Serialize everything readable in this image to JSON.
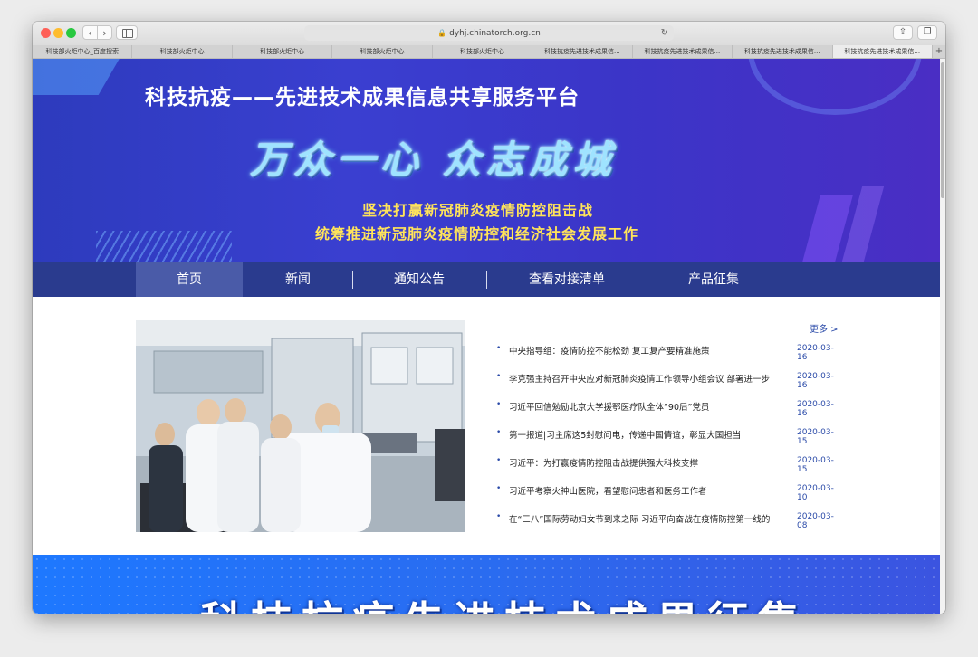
{
  "browser": {
    "url": "dyhj.chinatorch.org.cn",
    "tabs": [
      {
        "label": "科技部火炬中心_百度搜索",
        "active": false
      },
      {
        "label": "科技部火炬中心",
        "active": false
      },
      {
        "label": "科技部火炬中心",
        "active": false
      },
      {
        "label": "科技部火炬中心",
        "active": false
      },
      {
        "label": "科技部火炬中心",
        "active": false
      },
      {
        "label": "科技抗疫先进技术成果信...",
        "active": false
      },
      {
        "label": "科技抗疫先进技术成果信...",
        "active": false
      },
      {
        "label": "科技抗疫先进技术成果信...",
        "active": false
      },
      {
        "label": "科技抗疫先进技术成果信...",
        "active": true
      }
    ],
    "new_tab": "+"
  },
  "banner": {
    "title": "科技抗疫——先进技术成果信息共享服务平台",
    "slogan": "万众一心  众志成城",
    "sub1": "坚决打赢新冠肺炎疫情防控阻击战",
    "sub2": "统筹推进新冠肺炎疫情防控和经济社会发展工作"
  },
  "nav": {
    "items": [
      {
        "label": "首页",
        "active": true
      },
      {
        "label": "新闻",
        "active": false
      },
      {
        "label": "通知公告",
        "active": false
      },
      {
        "label": "查看对接清单",
        "active": false
      },
      {
        "label": "产品征集",
        "active": false
      }
    ]
  },
  "news": {
    "more": "更多 >",
    "items": [
      {
        "title": "中央指导组：疫情防控不能松劲 复工复产要精准施策",
        "date": "2020-03-16"
      },
      {
        "title": "李克强主持召开中央应对新冠肺炎疫情工作领导小组会议 部署进一步",
        "date": "2020-03-16"
      },
      {
        "title": "习近平回信勉励北京大学援鄂医疗队全体“90后”党员",
        "date": "2020-03-16"
      },
      {
        "title": "第一报道|习主席这5封慰问电，传递中国情谊，彰显大国担当",
        "date": "2020-03-15"
      },
      {
        "title": "习近平：为打赢疫情防控阻击战提供强大科技支撑",
        "date": "2020-03-15"
      },
      {
        "title": "习近平考察火神山医院，看望慰问患者和医务工作者",
        "date": "2020-03-10"
      },
      {
        "title": "在“三八”国际劳动妇女节到来之际 习近平向奋战在疫情防控第一线的",
        "date": "2020-03-08"
      }
    ]
  },
  "bottom_banner": {
    "title": "科技抗疫先进技术成果征集"
  },
  "icons": {
    "back": "‹",
    "forward": "›",
    "lock": "🔒",
    "reload": "↻",
    "share": "⇪",
    "tabs": "❐",
    "bullet": "•"
  },
  "colors": {
    "nav_bg": "#2a3b8e",
    "nav_active": "#4a5ba8",
    "link": "#2a4aa8",
    "slogan_yellow": "#ffe45a"
  }
}
